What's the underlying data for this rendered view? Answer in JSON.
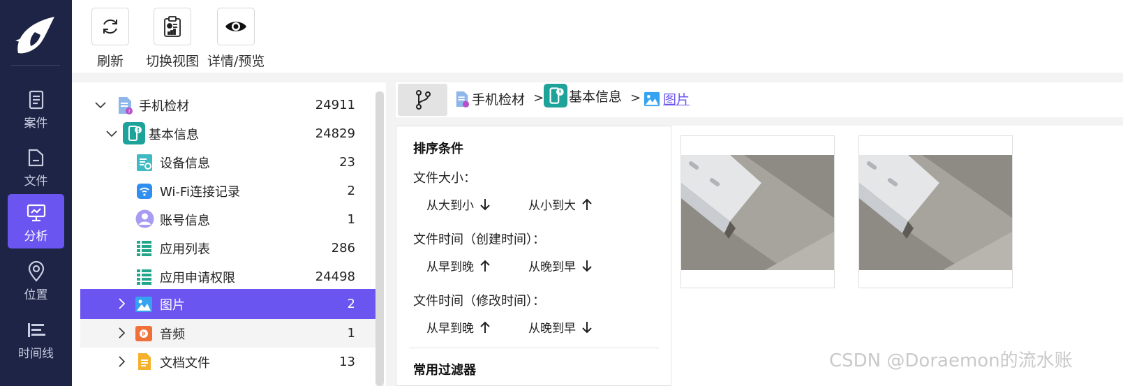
{
  "nav": {
    "items": [
      {
        "label": "案件",
        "icon": "document-icon"
      },
      {
        "label": "文件",
        "icon": "folder-icon"
      },
      {
        "label": "分析",
        "icon": "analysis-icon",
        "active": true
      },
      {
        "label": "位置",
        "icon": "location-icon"
      },
      {
        "label": "时间线",
        "icon": "timeline-icon"
      }
    ]
  },
  "toolbar": {
    "refresh_label": "刷新",
    "switch_view_label": "切换视图",
    "detail_preview_label": "详情/预览"
  },
  "tree": {
    "items": [
      {
        "label": "手机检材",
        "count": "24911"
      },
      {
        "label": "基本信息",
        "count": "24829"
      },
      {
        "label": "设备信息",
        "count": "23"
      },
      {
        "label": "Wi-Fi连接记录",
        "count": "2"
      },
      {
        "label": "账号信息",
        "count": "1"
      },
      {
        "label": "应用列表",
        "count": "286"
      },
      {
        "label": "应用申请权限",
        "count": "24498"
      },
      {
        "label": "图片",
        "count": "2"
      },
      {
        "label": "音频",
        "count": "1"
      },
      {
        "label": "文档文件",
        "count": "13"
      }
    ]
  },
  "breadcrumb": {
    "items": [
      "手机检材",
      "基本信息",
      "图片"
    ],
    "separator": ">"
  },
  "sort": {
    "title": "排序条件",
    "size_label": "文件大小：",
    "size_desc": "从大到小",
    "size_asc": "从小到大",
    "created_label": "文件时间（创建时间）：",
    "created_asc": "从早到晚",
    "created_desc": "从晚到早",
    "modified_label": "文件时间（修改时间）：",
    "modified_asc": "从早到晚",
    "modified_desc": "从晚到早",
    "filters_title": "常用过滤器"
  },
  "watermark": "CSDN @Doraemon的流水账",
  "colors": {
    "nav_bg": "#1d2445",
    "accent": "#6b55f0"
  }
}
